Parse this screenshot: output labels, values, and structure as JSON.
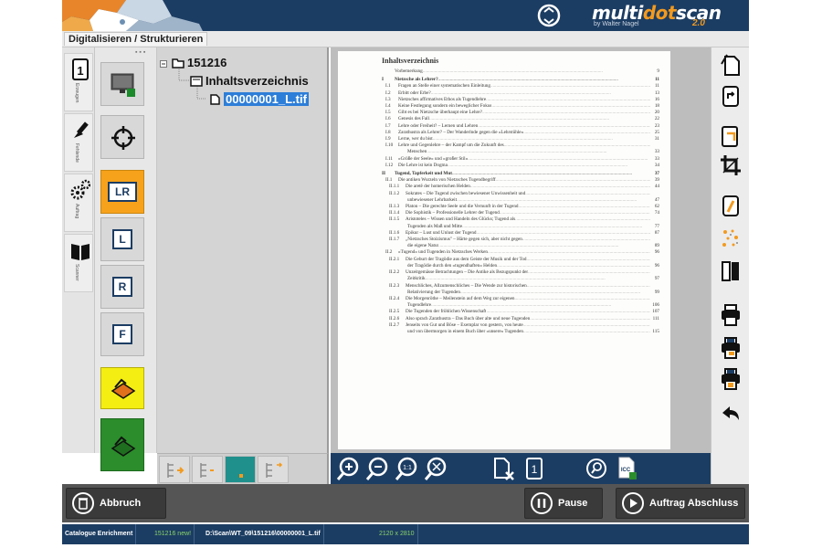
{
  "brand": {
    "name_part1": "multi",
    "name_part2": "dot",
    "name_part3": "scan",
    "byline": "by Walter Nagel",
    "version": "2.0"
  },
  "tab_title": "Digitalisieren / Strukturieren",
  "vtabs": [
    {
      "label": "Erzeugen",
      "icon": "document-one-icon"
    },
    {
      "label": "Fehlende",
      "icon": "brush-icon"
    },
    {
      "label": "Auftrag",
      "icon": "gears-icon"
    },
    {
      "label": "Scanner",
      "icon": "book-icon"
    }
  ],
  "tools": [
    {
      "name": "monitor-tool",
      "icon": "monitor-icon"
    },
    {
      "name": "crosshair-tool",
      "icon": "crosshair-icon"
    },
    {
      "name": "left-right-pages-tool",
      "letter": "LR"
    },
    {
      "name": "left-page-tool",
      "letter": "L"
    },
    {
      "name": "right-page-tool",
      "letter": "R"
    },
    {
      "name": "full-page-tool",
      "letter": "F"
    },
    {
      "name": "scan-preview-tool",
      "icon": "scanner-icon"
    },
    {
      "name": "scan-tool",
      "icon": "scanner-icon"
    }
  ],
  "tree": {
    "root": "151216",
    "child": "Inhaltsverzeichnis",
    "file": "00000001_L.tif"
  },
  "doc": {
    "title": "Inhaltsverzeichnis",
    "entries": [
      {
        "num": "",
        "text": "Vorbemerkung",
        "page": "9",
        "kind": "plain"
      },
      {
        "num": "I",
        "text": "Nietzsche als Lehrer?",
        "page": "11",
        "kind": "sec"
      },
      {
        "num": "I.1",
        "text": "Fragen an Stelle einer systematischen Einleitung",
        "page": "11",
        "kind": "sub"
      },
      {
        "num": "I.2",
        "text": "Erbitt oder Erbe?",
        "page": "13",
        "kind": "sub"
      },
      {
        "num": "I.3",
        "text": "Nietzsches affirmatives Ethos als Tugendlehre",
        "page": "16",
        "kind": "sub"
      },
      {
        "num": "I.4",
        "text": "Keine Festlegung sondern ein beweglicher Fokus",
        "page": "18",
        "kind": "sub"
      },
      {
        "num": "I.5",
        "text": "Gibt es bei Nietzsche überhaupt eine Lehre?",
        "page": "20",
        "kind": "sub"
      },
      {
        "num": "I.6",
        "text": "Genesis des Fall",
        "page": "22",
        "kind": "sub"
      },
      {
        "num": "I.7",
        "text": "Lehre oder Freiheit? – Lernen und Lehren",
        "page": "23",
        "kind": "sub"
      },
      {
        "num": "I.8",
        "text": "Zarathustra als Lehrer? – Der Wanderlnde gegen die »Lehrstühle«",
        "page": "25",
        "kind": "sub"
      },
      {
        "num": "I.9",
        "text": "Lerne, wer du bist",
        "page": "31",
        "kind": "sub"
      },
      {
        "num": "I.10",
        "text": "Lehre und Gegenlehre – der Kampf um die Zukunft des",
        "page": "",
        "kind": "sub"
      },
      {
        "num": "",
        "text": "Menschen",
        "page": "33",
        "kind": "cont"
      },
      {
        "num": "I.11",
        "text": "»Größe der Seele« und »großer Stil«",
        "page": "33",
        "kind": "sub"
      },
      {
        "num": "I.12",
        "text": "Die Lehre ist kein Dogma",
        "page": "34",
        "kind": "sub"
      },
      {
        "num": "II",
        "text": "Tugend, Tapferkeit und Mut",
        "page": "37",
        "kind": "sec"
      },
      {
        "num": "II.1",
        "text": "Die antiken Wurzeln von Nietzsches Tugendbegriff",
        "page": "39",
        "kind": "sub"
      },
      {
        "num": "II.1.1",
        "text": "Die aretē der homerischen Helden",
        "page": "44",
        "kind": "sub2"
      },
      {
        "num": "II.1.2",
        "text": "Sokrates – Die Tugend zwischen bewiesener Unwissenheit und",
        "page": "",
        "kind": "sub2"
      },
      {
        "num": "",
        "text": "unbewiesener Lehrbarkeit",
        "page": "47",
        "kind": "cont"
      },
      {
        "num": "II.1.3",
        "text": "Platon – Die gerechte Seele und die Vernunft in der Tugend",
        "page": "62",
        "kind": "sub2"
      },
      {
        "num": "II.1.4",
        "text": "Die Sophistik – Professionelle Lehrer der Tugend",
        "page": "74",
        "kind": "sub2"
      },
      {
        "num": "II.1.5",
        "text": "Aristoteles – Wissen und Handeln des Glücks; Tugend als",
        "page": "",
        "kind": "sub2"
      },
      {
        "num": "",
        "text": "Tugenden als Maß und Mitte",
        "page": "77",
        "kind": "cont"
      },
      {
        "num": "II.1.6",
        "text": "Epikur – Lust und Unlust der Tugend",
        "page": "87",
        "kind": "sub2"
      },
      {
        "num": "II.1.7",
        "text": "„Nietzsches Stoizismus\" – Härte gegen sich, aber nicht gegen",
        "page": "",
        "kind": "sub2"
      },
      {
        "num": "",
        "text": "die eigene Natur",
        "page": "89",
        "kind": "cont"
      },
      {
        "num": "II.2",
        "text": "»Tugend« und Tugenden in Nietzsches Werken",
        "page": "96",
        "kind": "sub"
      },
      {
        "num": "II.2.1",
        "text": "Die Geburt der Tragödie aus dem Geiste der Musik und der Tod",
        "page": "",
        "kind": "sub2"
      },
      {
        "num": "",
        "text": "der Tragödie durch den »tugendhaften« Helden",
        "page": "96",
        "kind": "cont"
      },
      {
        "num": "II.2.2",
        "text": "Unzeitgemässe Betrachtungen – Die Antike als Bezugspunkt der",
        "page": "",
        "kind": "sub2"
      },
      {
        "num": "",
        "text": "Zeitkritik",
        "page": "97",
        "kind": "cont"
      },
      {
        "num": "II.2.3",
        "text": "Menschliches, Allzumenschliches – Die Wende zur historischen",
        "page": "",
        "kind": "sub2"
      },
      {
        "num": "",
        "text": "Relativierung der Tugenden",
        "page": "99",
        "kind": "cont"
      },
      {
        "num": "II.2.4",
        "text": "Die Morgenröthe – Meilenstein auf dem Weg zur eigenen",
        "page": "",
        "kind": "sub2"
      },
      {
        "num": "",
        "text": "Tugendlehre",
        "page": "106",
        "kind": "cont"
      },
      {
        "num": "II.2.5",
        "text": "Die Tugenden der fröhlichen Wissenschaft",
        "page": "107",
        "kind": "sub2"
      },
      {
        "num": "II.2.6",
        "text": "Also sprach Zarathustra – Das Buch über alte und neue Tugenden",
        "page": "111",
        "kind": "sub2"
      },
      {
        "num": "II.2.7",
        "text": "Jenseits von Gut und Böse – Exemplar von gestern, von heute",
        "page": "",
        "kind": "sub2"
      },
      {
        "num": "",
        "text": "und von übermorgen in einem Buch über »unsere« Tugenden",
        "page": "115",
        "kind": "cont"
      }
    ]
  },
  "viewer_tools": [
    "zoom-in-icon",
    "zoom-out-icon",
    "zoom-actual-icon",
    "zoom-fit-icon",
    "delete-page-icon",
    "page-one-icon",
    "search-icon",
    "icc-profile-icon"
  ],
  "right_tools": [
    "rotate-page-icon",
    "rotate-right-icon",
    "crop-page-icon",
    "crop-icon",
    "deskew-icon",
    "despeckle-icon",
    "split-page-icon",
    "print-icon",
    "print-pdf-icon",
    "print-pdf-a-icon",
    "undo-icon"
  ],
  "actions": {
    "cancel": "Abbruch",
    "pause": "Pause",
    "finish": "Auftrag Abschluss"
  },
  "status": {
    "module": "Catalogue Enrichment",
    "id": "151216 new!",
    "path": "D:\\Scan\\WT_09\\151216\\00000001_L.tif",
    "size": "2120 x 2810"
  }
}
